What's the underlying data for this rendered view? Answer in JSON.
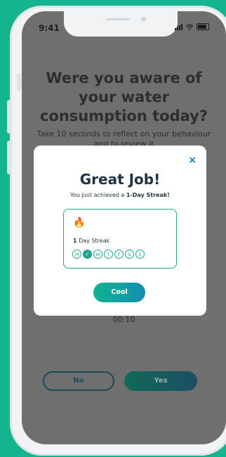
{
  "status_bar": {
    "time": "9:41"
  },
  "background": {
    "heading": "Were you aware of your water consumption today?",
    "subtitle": "Take 10 seconds to reflect on your behaviour and to review it",
    "timer": "00:10",
    "no_label": "No",
    "yes_label": "Yes"
  },
  "modal": {
    "close_icon": "×",
    "title": "Great Job!",
    "subtitle_prefix": "You just achieved a ",
    "subtitle_bold": "1-Day Streak!",
    "streak_icon": "🔥",
    "streak_count": "1",
    "streak_text": " Day Streak",
    "days": [
      {
        "letter": "M",
        "done": false
      },
      {
        "letter": "✓",
        "done": true
      },
      {
        "letter": "W",
        "done": false
      },
      {
        "letter": "T",
        "done": false
      },
      {
        "letter": "F",
        "done": false
      },
      {
        "letter": "S",
        "done": false
      },
      {
        "letter": "S",
        "done": false
      }
    ],
    "button_label": "Cool"
  },
  "colors": {
    "background": "#14b48e",
    "accent": "#1fa58a",
    "title": "#1f3340",
    "close": "#0f7fc9"
  }
}
